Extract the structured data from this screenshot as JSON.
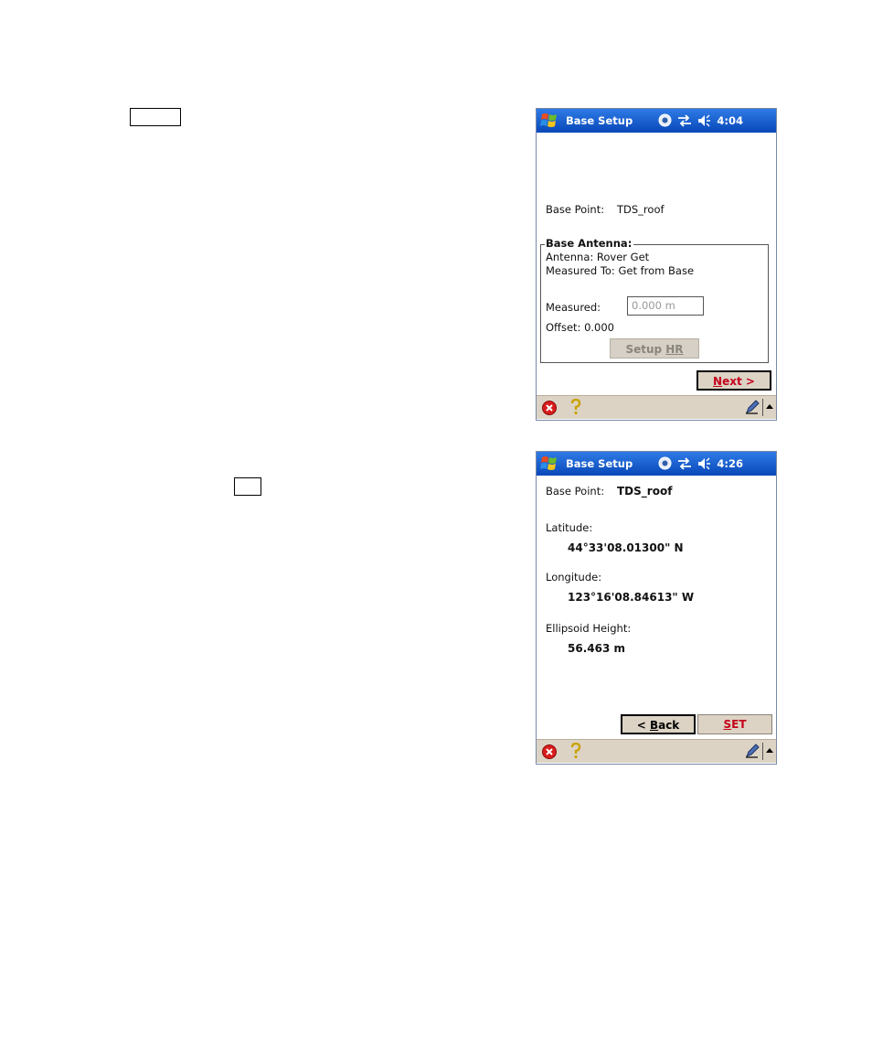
{
  "screen1": {
    "title": "Base Setup",
    "time": "4:04",
    "base_point_label": "Base Point:",
    "base_point_value": "TDS_roof",
    "antenna_group_title": "Base Antenna:",
    "antenna_line": "Antenna: Rover Get",
    "measured_to_line": "Measured To: Get from Base",
    "measured_label": "Measured:",
    "measured_value": "0.000 m",
    "offset_line": "Offset: 0.000",
    "setup_hr_pre": "Setup ",
    "setup_hr_ul": "HR",
    "next_ul": "N",
    "next_rest": "ext >"
  },
  "screen2": {
    "title": "Base Setup",
    "time": "4:26",
    "base_point_label": "Base Point:",
    "base_point_value": "TDS_roof",
    "latitude_label": "Latitude:",
    "latitude_value": "44°33'08.01300\" N",
    "longitude_label": "Longitude:",
    "longitude_value": "123°16'08.84613\" W",
    "height_label": "Ellipsoid Height:",
    "height_value": "56.463 m",
    "back_pre": "< ",
    "back_ul": "B",
    "back_rest": "ack",
    "set_ul": "S",
    "set_rest": "ET"
  },
  "icons": [
    "windows-start-icon",
    "gps-status-icon",
    "connectivity-icon",
    "volume-icon",
    "close-icon",
    "help-icon",
    "pen-input-icon",
    "input-menu-arrow-icon"
  ],
  "colors": {
    "titlebar": "#0847b8",
    "bottombar": "#dcd3c4",
    "accent_red": "#c4001a"
  }
}
